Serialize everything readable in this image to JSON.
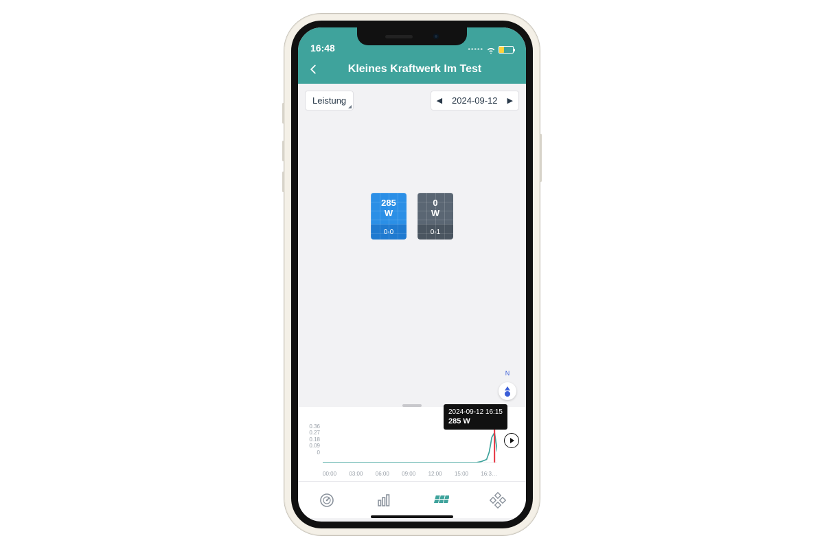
{
  "status": {
    "time": "16:48"
  },
  "header": {
    "title": "Kleines Kraftwerk Im Test"
  },
  "toolbar": {
    "metric_label": "Leistung",
    "date": "2024-09-12"
  },
  "panels": [
    {
      "value": "285",
      "unit": "W",
      "id": "0-0",
      "state": "active"
    },
    {
      "value": "0",
      "unit": "W",
      "id": "0-1",
      "state": "idle"
    }
  ],
  "compass": {
    "label": "N"
  },
  "tooltip": {
    "timestamp": "2024-09-12 16:15",
    "value": "285 W"
  },
  "chart_data": {
    "type": "line",
    "title": "",
    "xlabel": "",
    "ylabel": "",
    "ylim": [
      0,
      0.36
    ],
    "y_ticks": [
      0,
      0.09,
      0.18,
      0.27,
      0.36
    ],
    "x_ticks": [
      "00:00",
      "03:00",
      "06:00",
      "09:00",
      "12:00",
      "15:00",
      "16:3…"
    ],
    "cursor_x": "16:15",
    "annotation": {
      "x": "16:15",
      "label": "285 W"
    },
    "series": [
      {
        "name": "Leistung (kW)",
        "color": "#3fa39c",
        "x": [
          "00:00",
          "03:00",
          "06:00",
          "09:00",
          "12:00",
          "14:30",
          "15:00",
          "15:30",
          "15:45",
          "16:00",
          "16:15",
          "16:30",
          "16:45"
        ],
        "y": [
          0,
          0,
          0,
          0,
          0,
          0,
          0.01,
          0.03,
          0.1,
          0.24,
          0.285,
          0.12,
          0.02
        ]
      }
    ]
  }
}
